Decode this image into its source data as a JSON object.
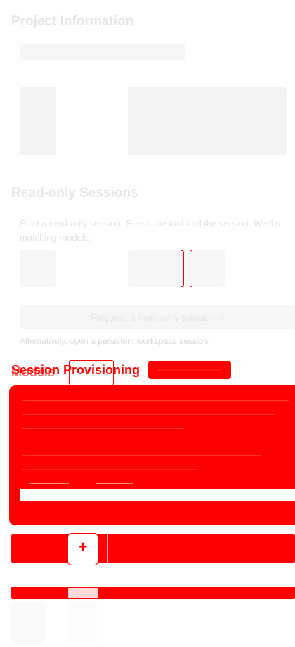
{
  "project": {
    "title": "Project Information"
  },
  "read_only": {
    "title": "Read-only Sessions",
    "description": "Start a read-only session. Select the tool and the version. We'll s",
    "description_2": "matching models.",
    "request_button": "Request a read-only session  >",
    "alternative_prefix": "Alternatively, open a ",
    "alternative_link": "persistent workspace session.",
    "alternative_suffix": ""
  },
  "session_provisioning": {
    "title": "Session Provisioning",
    "ghost_title": "Models"
  },
  "stepper": {
    "plus_label": "+"
  },
  "colors": {
    "accent": "#ff0000",
    "faint_text": "#e6e6e6",
    "faint_box": "#f6f6f6"
  }
}
